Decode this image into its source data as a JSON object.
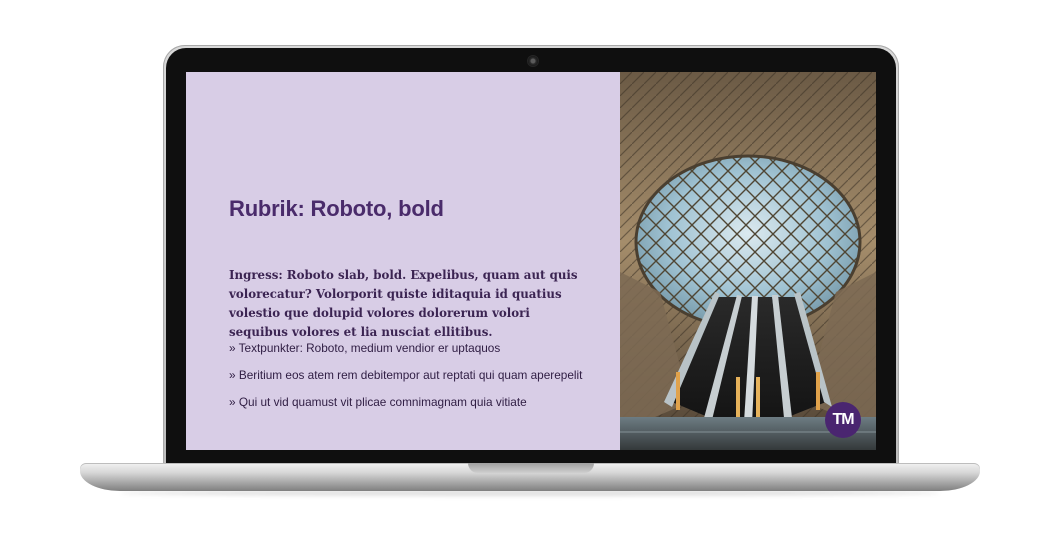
{
  "slide": {
    "title": "Rubrik: Roboto, bold",
    "ingress": "Ingress: Roboto slab, bold. Expelibus, quam aut quis volorecatur? Volorporit quiste iditaquia id quatius volestio que dolupid volores dolorerum volori sequibus volores et lia nusciat ellitibus.",
    "bullets": [
      "» Textpunkter: Roboto, medium vendior er uptaquos",
      "» Beritium eos atem rem debitempor aut reptati qui quam aperepelit",
      "» Qui ut vid quamust vit plicae comnimagnam quia vitiate"
    ],
    "badge_text": "TM",
    "image_subject": "escalators under glass dome"
  },
  "colors": {
    "slide_background": "#d8cde6",
    "title": "#4a2b6b",
    "text": "#3b2452",
    "badge": "#4a2570",
    "bezel": "#0f0f0f"
  },
  "icons": {
    "camera": "camera-icon",
    "badge": "tm-logo-icon"
  }
}
